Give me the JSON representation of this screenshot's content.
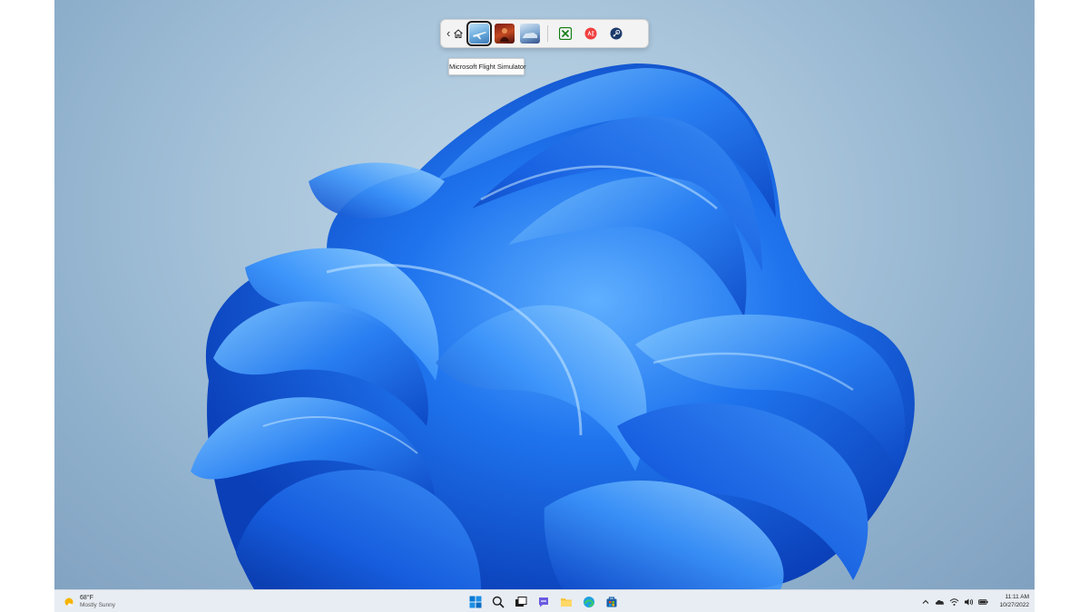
{
  "gamebar": {
    "back_glyph": "‹",
    "tooltip": "Microsoft Flight Simulator",
    "games": [
      {
        "icon": "flight-simulator-tile",
        "selected": true
      },
      {
        "icon": "red-game-tile",
        "selected": false
      },
      {
        "icon": "forza-game-tile",
        "selected": false
      }
    ],
    "launchers": [
      {
        "icon": "xbox-icon",
        "color": "#107c10"
      },
      {
        "icon": "ea-icon",
        "color": "#f04040"
      },
      {
        "icon": "steam-icon",
        "color": "#1b3a6b"
      }
    ]
  },
  "taskbar": {
    "weather": {
      "temp": "68°F",
      "condition": "Mostly Sunny",
      "icon": "sun-cloud-icon"
    },
    "center_icons": [
      "windows-start-icon",
      "search-icon",
      "task-view-icon",
      "chat-icon",
      "file-explorer-icon",
      "edge-icon",
      "store-icon"
    ],
    "tray_chevron": "^",
    "time": "11:11 AM",
    "date": "10/27/2022"
  },
  "colors": {
    "accent": "#0067c0",
    "bloom_blue": "#1a64e6",
    "taskbar_bg": "#e8edf3"
  }
}
